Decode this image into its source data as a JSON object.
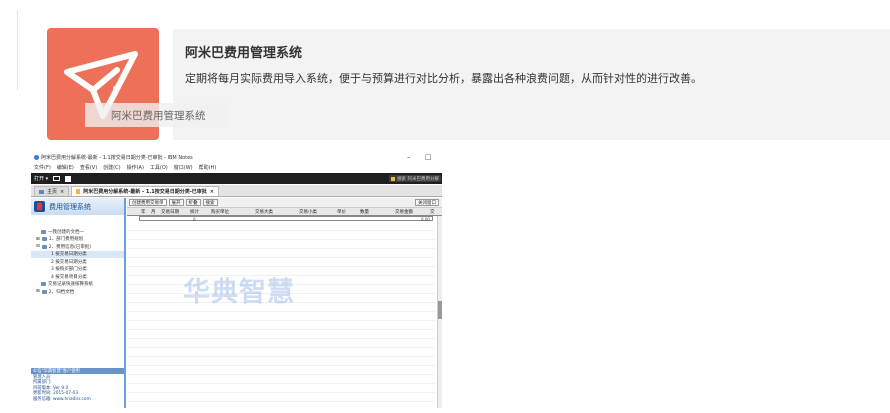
{
  "hero": {
    "title": "阿米巴费用管理系统",
    "description": "定期将每月实际费用导入系统，便于与预算进行对比分析，暴露出各种浪费问题，从而针对性的进行改善。",
    "icon_color": "#ec7158",
    "icon": "paper-plane-icon"
  },
  "screenshot": {
    "window_title": "阿米巴费用分解系统-最新 - 1.1按交易日期分类-已审批 - IBM Notes",
    "window_min": "–",
    "window_max": "□",
    "menu": [
      "文件(F)",
      "编辑(E)",
      "查看(V)",
      "创建(C)",
      "操作(A)",
      "工具(O)",
      "窗口(W)",
      "帮助(H)"
    ],
    "toolbar_open": "打开 ▾",
    "toolbar_user": "搜索 阿米巴费用分解",
    "tabs": [
      {
        "label": "主页"
      },
      {
        "label": "阿米巴费用分解系统-最新 - 1.1按交易日期分类-已审批"
      }
    ],
    "sidebar": {
      "header": "费用管理系统",
      "items": [
        "一我创建的文档一",
        "1、部门费用规划",
        "2、费用信息(已审批)",
        "1  按交易日期分类",
        "2  按交易日期分类",
        "3  按购买部门分类",
        "4  按交易项目分类",
        "交易记录快速核算系统",
        "2、归档文档"
      ],
      "footer_header": "©信\"华典智慧\"客户使用",
      "footer_lines": [
        "管理人员:",
        "所属部门:",
        "目前版本: Ver 9.0",
        "更新时间: 2015-07-03",
        "服务信箱: www.hnadisr.com"
      ]
    },
    "actions": [
      "创建费用交易单",
      "展开",
      "折叠",
      "搜索"
    ],
    "close_window": "关闭窗口",
    "columns": [
      "年",
      "月",
      "交易日期",
      "统计",
      "购买单位",
      "交易大类",
      "交易小类",
      "单价",
      "数量",
      "交易金额",
      "交"
    ],
    "sum_count": "0",
    "sum_amount": "0.00"
  },
  "watermark": {
    "label": "阿米巴费用管理系统",
    "brand": "华典智慧"
  }
}
